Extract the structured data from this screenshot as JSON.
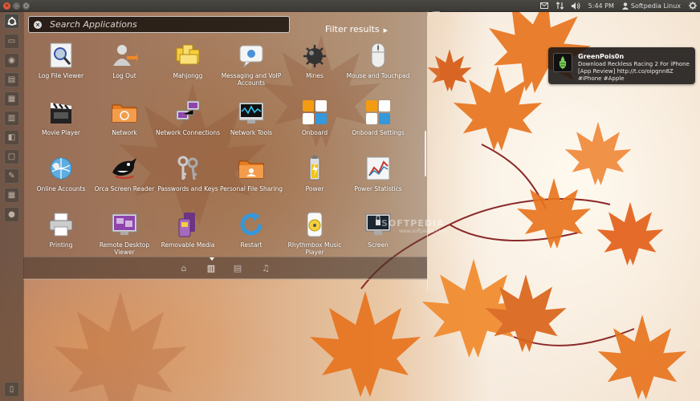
{
  "top_panel": {
    "window_controls": {
      "close": "×",
      "minimize": "–",
      "maximize": "○"
    },
    "time": "5:44 PM",
    "user": "Softpedia Linux",
    "icons": [
      "mail-icon",
      "network-icon",
      "volume-icon",
      "user-icon",
      "gear-icon"
    ]
  },
  "dash": {
    "search_placeholder": "Search Applications",
    "filter_label": "Filter results",
    "apps": [
      {
        "label": "Log File Viewer",
        "icon": "log-viewer-icon"
      },
      {
        "label": "Log Out",
        "icon": "logout-icon"
      },
      {
        "label": "Mahjongg",
        "icon": "mahjongg-icon"
      },
      {
        "label": "Messaging and VoIP Accounts",
        "icon": "messaging-icon"
      },
      {
        "label": "Mines",
        "icon": "mines-icon"
      },
      {
        "label": "Mouse and Touchpad",
        "icon": "mouse-icon"
      },
      {
        "label": "Movie Player",
        "icon": "clapperboard-icon"
      },
      {
        "label": "Network",
        "icon": "network-folder-icon"
      },
      {
        "label": "Network Connections",
        "icon": "network-connections-icon"
      },
      {
        "label": "Network Tools",
        "icon": "network-tools-icon"
      },
      {
        "label": "Onboard",
        "icon": "onboard-keyboard-icon"
      },
      {
        "label": "Onboard Settings",
        "icon": "onboard-settings-icon"
      },
      {
        "label": "Online Accounts",
        "icon": "online-accounts-icon"
      },
      {
        "label": "Orca Screen Reader",
        "icon": "orca-icon"
      },
      {
        "label": "Passwords and Keys",
        "icon": "keys-icon"
      },
      {
        "label": "Personal File Sharing",
        "icon": "file-sharing-icon"
      },
      {
        "label": "Power",
        "icon": "battery-icon"
      },
      {
        "label": "Power Statistics",
        "icon": "power-stats-icon"
      },
      {
        "label": "Printing",
        "icon": "printer-icon"
      },
      {
        "label": "Remote Desktop Viewer",
        "icon": "remote-desktop-icon"
      },
      {
        "label": "Removable Media",
        "icon": "removable-media-icon"
      },
      {
        "label": "Restart",
        "icon": "restart-icon"
      },
      {
        "label": "Rhythmbox Music Player",
        "icon": "rhythmbox-icon"
      },
      {
        "label": "Screen",
        "icon": "screen-icon"
      }
    ],
    "lenses": [
      {
        "name": "home",
        "icon": "home-icon"
      },
      {
        "name": "applications",
        "icon": "applications-icon",
        "active": true
      },
      {
        "name": "files",
        "icon": "files-icon"
      },
      {
        "name": "music",
        "icon": "music-icon"
      }
    ]
  },
  "watermark": {
    "text": "SOFTPEDIA",
    "sub": "www.softpedia.com"
  },
  "notification": {
    "title": "GreenPois0n",
    "body": "Download Reckless Racing 2 For iPhone [App Review] http://t.co/oipgnn8Z #iPhone #Apple"
  },
  "colors": {
    "accent": "#e0583a",
    "panel": "#3b3a36",
    "leaf": "#e8741e"
  }
}
